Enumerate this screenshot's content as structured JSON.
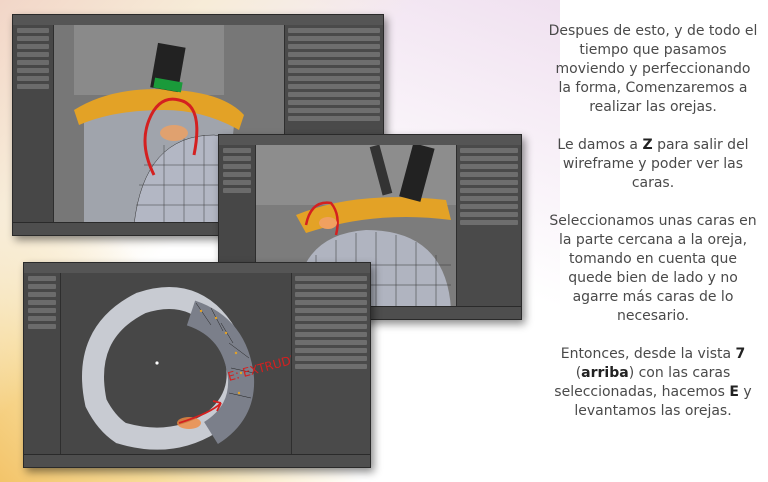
{
  "paragraphs": {
    "p1": "Despues de esto, y de todo el tiempo que pasamos moviendo y perfeccionando la forma, Comenzaremos a realizar las orejas.",
    "p2_a": "Le damos a ",
    "p2_key": "Z",
    "p2_b": " para salir del wireframe y poder ver las caras.",
    "p3": "Seleccionamos unas caras en la parte cercana a la oreja, tomando en cuenta que quede bien de lado y no agarre más caras de lo necesario.",
    "p4_a": "Entonces, desde la vista ",
    "p4_num": "7",
    "p4_b": " (",
    "p4_word": "arriba",
    "p4_c": ") con las caras seleccionadas, hacemos ",
    "p4_key": "E",
    "p4_d": " y levantamos las orejas."
  },
  "annotation": {
    "extrude_text": "E: EXTRUDE"
  },
  "colors": {
    "accent_red": "#d42020",
    "yellow_ear": "#e3a226",
    "text": "#4a4a4a"
  }
}
